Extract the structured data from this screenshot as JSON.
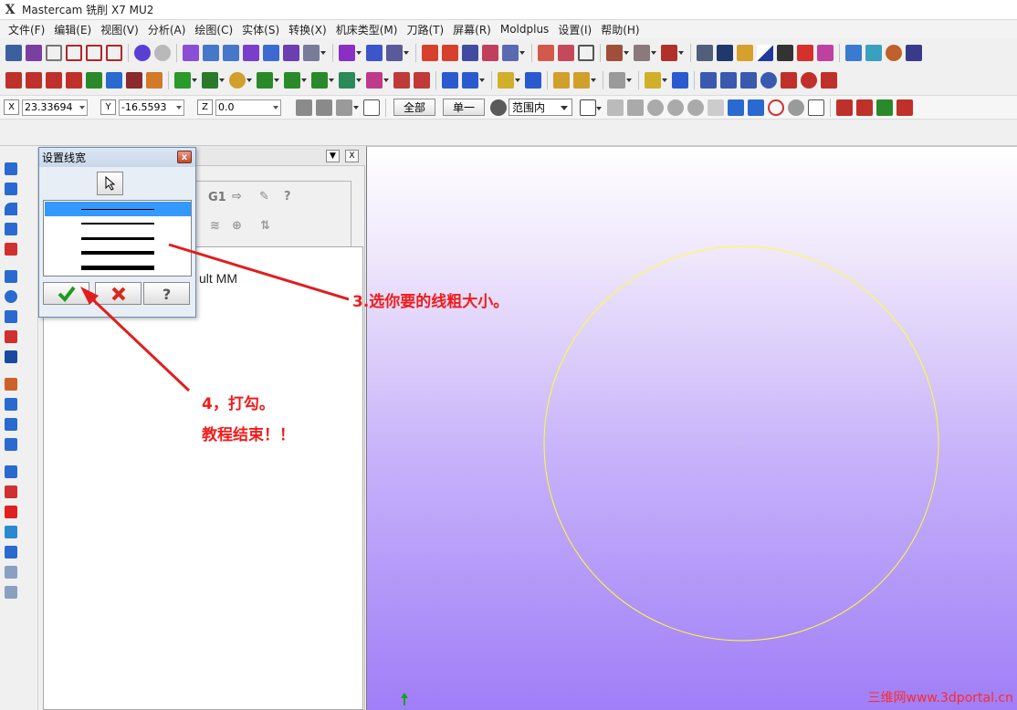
{
  "window": {
    "title": "Mastercam 铣削 X7 MU2"
  },
  "menu": [
    "文件(F)",
    "编辑(E)",
    "视图(V)",
    "分析(A)",
    "绘图(C)",
    "实体(S)",
    "转换(X)",
    "机床类型(M)",
    "刀路(T)",
    "屏幕(R)",
    "Moldplus",
    "设置(I)",
    "帮助(H)"
  ],
  "coords": {
    "x_label": "X",
    "x_value": "23.33694",
    "y_label": "Y",
    "y_value": "-16.5593",
    "z_label": "Z",
    "z_value": "0.0"
  },
  "selection": {
    "all_label": "全部",
    "single_label": "单一",
    "range_value": "范围内"
  },
  "panel": {
    "tree_text": "ult MM",
    "g1_label": "G1"
  },
  "dialog": {
    "title": "设置线宽",
    "close_glyph": "x",
    "line_widths": [
      1,
      2,
      3,
      4,
      5
    ],
    "selected_index": 0
  },
  "annotations": {
    "step3": "3.选你要的线粗大小。",
    "step4_line1": "4，打勾。",
    "step4_line2": "教程结束！！"
  },
  "viewport": {
    "circle_color": "#ffff33",
    "gradient_top": "#ffffff",
    "gradient_bottom": "#a07ef7",
    "watermark": "三维网www.3dportal.cn"
  },
  "colors": {
    "annotation": "#f21b1b",
    "selection": "#3399ff"
  }
}
